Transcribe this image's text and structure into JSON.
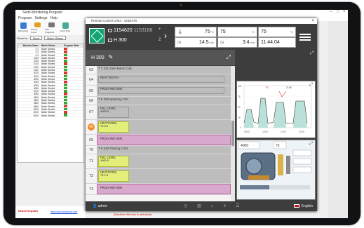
{
  "background_app": {
    "title": "Sedo Monitoring Program",
    "menu": [
      "Program",
      "Settings",
      "Help"
    ],
    "toolbar": [
      "Monitoring",
      "History Curve",
      "Print Programs",
      "Copy Prog"
    ],
    "filter_label": "Show for",
    "filter_value": "None",
    "filter_value2": "Batch Status",
    "table_headers": [
      "Machine Name",
      "Batch Status",
      "Program State"
    ],
    "rows": [
      {
        "machine": "0,1",
        "status": "Batch Started",
        "color": "#d33"
      },
      {
        "machine": "0,2",
        "status": "Batch Started",
        "color": "#d33"
      },
      {
        "machine": "0,3",
        "status": "Batch Started",
        "color": "#3a3"
      },
      {
        "machine": "1003",
        "status": "Batch Started",
        "color": "#d33"
      },
      {
        "machine": "1004",
        "status": "Batch Started",
        "color": "#3a3"
      },
      {
        "machine": "1010",
        "status": "Batch Started",
        "color": "#d33"
      },
      {
        "machine": "1020",
        "status": "Batch Started",
        "color": "#3a3"
      },
      {
        "machine": "1030",
        "status": "Batch Started",
        "color": "#3a3"
      },
      {
        "machine": "4010",
        "status": "Batch Started",
        "color": "#d33"
      },
      {
        "machine": "4020",
        "status": "Batch Started",
        "color": "#3a3"
      },
      {
        "machine": "4030",
        "status": "Batch Started",
        "color": "#3a3"
      },
      {
        "machine": "4040",
        "status": "Batch Started",
        "color": "#d33"
      },
      {
        "machine": "4050",
        "status": "Batch Started",
        "color": "#3a3"
      },
      {
        "machine": "4060",
        "status": "Batch Started",
        "color": "#3a3"
      },
      {
        "machine": "4070",
        "status": "Batch Started",
        "color": "#3a3"
      },
      {
        "machine": "4080",
        "status": "Batch Started",
        "color": "#d33"
      },
      {
        "machine": "4620",
        "status": "Batch Started",
        "color": "#3a3"
      },
      {
        "machine": "4630",
        "status": "Batch Started",
        "color": "#3a3"
      },
      {
        "machine": "4640",
        "status": "Batch Started",
        "color": "#3a3"
      },
      {
        "machine": "4650",
        "status": "Batch Started",
        "color": "#d33"
      },
      {
        "machine": "6000",
        "status": "Batch Started",
        "color": "#3a3"
      },
      {
        "machine": "6010",
        "status": "Batch Started",
        "color": "#d33"
      },
      {
        "machine": "6020",
        "status": "Batch Started",
        "color": "#3a3"
      }
    ],
    "logo": "SedoTreepoint",
    "logo_link": "www.sedo-treepoint.com",
    "hint": "(Machine Window is activated)"
  },
  "window": {
    "title": "Remote Control 1003 - 154D478",
    "close_glyph": "×",
    "batch_id": "1154820",
    "batch_id_secondary": "1153188",
    "machine": "H 300",
    "arrows_top": "+",
    "arrows_bottom": "2",
    "measurements": [
      {
        "value": "75",
        "unit": "°C",
        "extra": "⇩1"
      },
      {
        "value": "75",
        "unit": "°C",
        "extra": "⇩"
      },
      {
        "value": "75",
        "unit": "°C",
        "extra": ""
      },
      {
        "value": "14.5",
        "unit": "min",
        "extra": ""
      },
      {
        "value": "3.4",
        "unit": "min",
        "extra": ""
      },
      {
        "value": "11:44:04",
        "unit": "",
        "extra": ""
      }
    ],
    "program_name": "H 300",
    "user": "admin",
    "language": "English"
  },
  "steps": [
    {
      "num": "63",
      "style": "gray",
      "header": "T 7 321 Next Batch Call",
      "blocks": []
    },
    {
      "num": "64",
      "style": "gray",
      "header": "",
      "blocks": [
        {
          "label": "NEXT BATCH",
          "sub": "",
          "color": "gr"
        }
      ]
    },
    {
      "num": "65",
      "style": "gray",
      "header": "",
      "blocks": [
        {
          "label": "PROG RETURN",
          "sub": "",
          "color": "gr"
        }
      ]
    },
    {
      "num": "66",
      "style": "gray",
      "header": "T 8 300 Washing 70C",
      "blocks": []
    },
    {
      "num": "67",
      "style": "gray",
      "header": "",
      "blocks": [
        {
          "label": "FILL LEVEL",
          "sub": "4000     0",
          "color": "gr"
        }
      ]
    },
    {
      "num": "68",
      "style": "gray",
      "header": "",
      "blocks": [
        {
          "label": "HEAT/COOL",
          "sub": "75     5.5",
          "color": "yel"
        }
      ],
      "active": true
    },
    {
      "num": "69",
      "style": "pink",
      "header": "",
      "blocks": [
        {
          "label": "PROG RETURN",
          "sub": "",
          "color": "pink"
        }
      ]
    },
    {
      "num": "70",
      "style": "gray",
      "header": "T 9 340 Rinsing Cold",
      "blocks": []
    },
    {
      "num": "71",
      "style": "gray",
      "header": "",
      "blocks": [
        {
          "label": "FILL LEVEL",
          "sub": "4000     0",
          "color": "yel"
        }
      ]
    },
    {
      "num": "72",
      "style": "gray",
      "header": "",
      "blocks": [
        {
          "label": "HEAT/COOL",
          "sub": "75     2.5",
          "color": "yel"
        }
      ]
    },
    {
      "num": "73",
      "style": "pink",
      "header": "",
      "blocks": [
        {
          "label": "PROG RETURN",
          "sub": "",
          "color": "pink"
        }
      ]
    }
  ],
  "mini_chart": {
    "legend": [
      "75",
      "3.34"
    ],
    "y_ticks": [
      "100",
      "75",
      "50",
      "25",
      "0"
    ],
    "x_ticks": [
      "09:00",
      "10:00",
      "11:00",
      "12:00"
    ]
  },
  "mimic": {
    "readout": "4000",
    "readout2": "75"
  },
  "icons": [
    "gem-icon",
    "menu-icon",
    "expand-icon",
    "edit-icon",
    "clock-icon",
    "temperature-icon",
    "flag-icon"
  ]
}
